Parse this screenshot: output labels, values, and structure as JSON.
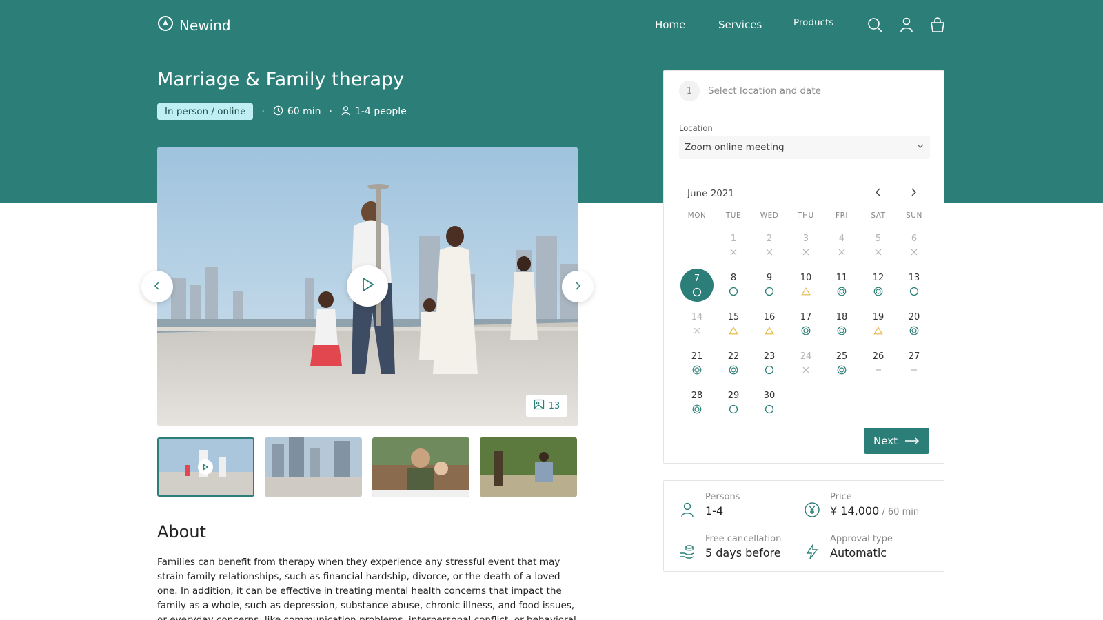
{
  "brand": {
    "name": "Newind"
  },
  "nav": {
    "home": "Home",
    "services": "Services",
    "products": "Products"
  },
  "colors": {
    "primary": "#2b7f78",
    "tag_bg": "#bfeef3",
    "warning": "#e5b740"
  },
  "icons": {
    "search": "search-icon",
    "account": "user-icon",
    "cart": "shopping-bag-icon"
  },
  "service": {
    "title": "Marriage & Family therapy",
    "tag": "In person / online",
    "duration": "60 min",
    "people": "1-4 people"
  },
  "gallery": {
    "photo_count": "13",
    "thumbnails": 4
  },
  "about": {
    "heading": "About",
    "text": "Families can benefit from therapy when they experience any stressful event that may strain family relationships, such as financial hardship, divorce, or the death of a loved one. In addition, it can be effective in treating mental health concerns that impact the family as a whole, such as depression, substance abuse, chronic illness, and food issues, or everyday concerns, like communication problems, interpersonal conflict, or behavioral problems in"
  },
  "booking": {
    "step_number": "1",
    "step_label": "Select location and date",
    "location_label": "Location",
    "location_value": "Zoom online meeting",
    "month": "June 2021",
    "weekdays": [
      "MON",
      "TUE",
      "WED",
      "THU",
      "FRI",
      "SAT",
      "SUN"
    ],
    "days": [
      {
        "d": "1",
        "s": "x"
      },
      {
        "d": "2",
        "s": "x"
      },
      {
        "d": "3",
        "s": "x"
      },
      {
        "d": "4",
        "s": "x"
      },
      {
        "d": "5",
        "s": "x"
      },
      {
        "d": "6",
        "s": "x"
      },
      {
        "d": "7",
        "s": "circle",
        "selected": true
      },
      {
        "d": "8",
        "s": "circle"
      },
      {
        "d": "9",
        "s": "circle"
      },
      {
        "d": "10",
        "s": "triangle"
      },
      {
        "d": "11",
        "s": "double"
      },
      {
        "d": "12",
        "s": "double"
      },
      {
        "d": "13",
        "s": "circle"
      },
      {
        "d": "14",
        "s": "x"
      },
      {
        "d": "15",
        "s": "triangle"
      },
      {
        "d": "16",
        "s": "triangle"
      },
      {
        "d": "17",
        "s": "double"
      },
      {
        "d": "18",
        "s": "double"
      },
      {
        "d": "19",
        "s": "triangle"
      },
      {
        "d": "20",
        "s": "double"
      },
      {
        "d": "21",
        "s": "double"
      },
      {
        "d": "22",
        "s": "double"
      },
      {
        "d": "23",
        "s": "circle"
      },
      {
        "d": "24",
        "s": "x"
      },
      {
        "d": "25",
        "s": "double"
      },
      {
        "d": "26",
        "s": "dash"
      },
      {
        "d": "27",
        "s": "dash"
      },
      {
        "d": "28",
        "s": "double"
      },
      {
        "d": "29",
        "s": "circle"
      },
      {
        "d": "30",
        "s": "circle"
      }
    ],
    "first_weekday_offset": 1,
    "next_label": "Next"
  },
  "info": {
    "persons_label": "Persons",
    "persons_value": "1-4",
    "price_label": "Price",
    "price_value": "¥ 14,000",
    "price_unit": " / 60 min",
    "cancel_label": "Free cancellation",
    "cancel_value": "5 days before",
    "approval_label": "Approval type",
    "approval_value": "Automatic"
  }
}
